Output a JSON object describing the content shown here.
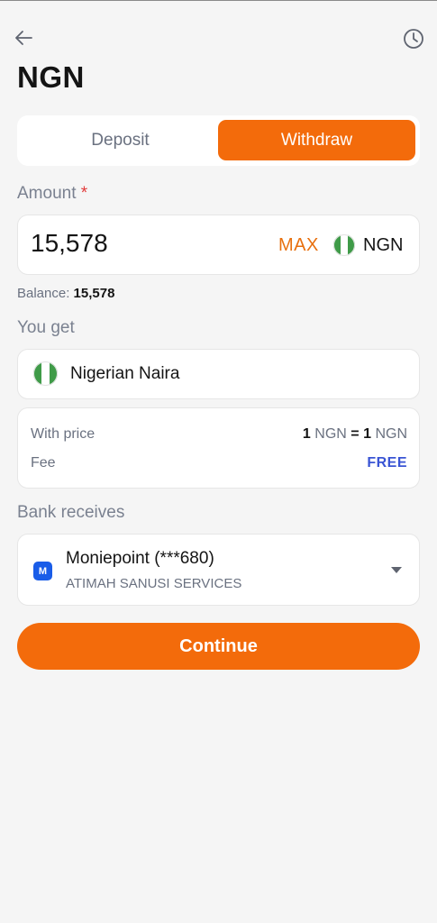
{
  "header": {
    "title": "NGN",
    "back_icon": "arrow-left-icon",
    "history_icon": "clock-icon"
  },
  "tabs": [
    {
      "label": "Deposit",
      "active": false
    },
    {
      "label": "Withdraw",
      "active": true
    }
  ],
  "amount": {
    "label": "Amount",
    "required_mark": "*",
    "value": "15,578",
    "max_label": "MAX",
    "currency": "NGN"
  },
  "balance": {
    "label": "Balance:",
    "value": "15,578"
  },
  "receive": {
    "label": "You get",
    "currency_name": "Nigerian Naira"
  },
  "price": {
    "label": "With price",
    "lhs_amount": "1",
    "lhs_currency": "NGN",
    "equals": "=",
    "rhs_amount": "1",
    "rhs_currency": "NGN",
    "fee_label": "Fee",
    "fee_value": "FREE"
  },
  "bank": {
    "label": "Bank receives",
    "logo_letter": "M",
    "name": "Moniepoint (***680)",
    "holder": "ATIMAH SANUSI SERVICES"
  },
  "continue_label": "Continue",
  "colors": {
    "accent": "#f36b0b",
    "max": "#e8700f",
    "free": "#3a55d4",
    "bank_logo": "#1a5de8",
    "flag_green": "#3f9b48"
  }
}
